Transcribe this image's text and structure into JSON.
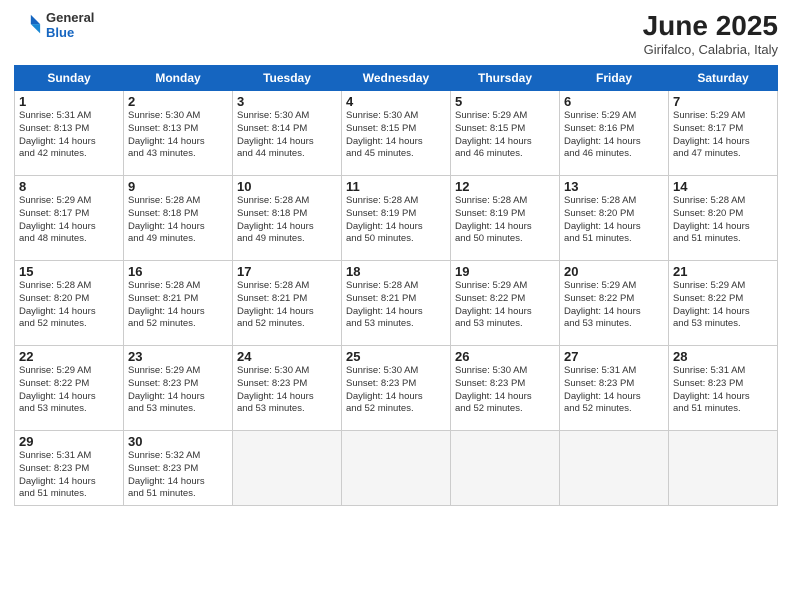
{
  "logo": {
    "general": "General",
    "blue": "Blue"
  },
  "title": "June 2025",
  "subtitle": "Girifalco, Calabria, Italy",
  "headers": [
    "Sunday",
    "Monday",
    "Tuesday",
    "Wednesday",
    "Thursday",
    "Friday",
    "Saturday"
  ],
  "weeks": [
    [
      {
        "day": "1",
        "info": "Sunrise: 5:31 AM\nSunset: 8:13 PM\nDaylight: 14 hours\nand 42 minutes."
      },
      {
        "day": "2",
        "info": "Sunrise: 5:30 AM\nSunset: 8:13 PM\nDaylight: 14 hours\nand 43 minutes."
      },
      {
        "day": "3",
        "info": "Sunrise: 5:30 AM\nSunset: 8:14 PM\nDaylight: 14 hours\nand 44 minutes."
      },
      {
        "day": "4",
        "info": "Sunrise: 5:30 AM\nSunset: 8:15 PM\nDaylight: 14 hours\nand 45 minutes."
      },
      {
        "day": "5",
        "info": "Sunrise: 5:29 AM\nSunset: 8:15 PM\nDaylight: 14 hours\nand 46 minutes."
      },
      {
        "day": "6",
        "info": "Sunrise: 5:29 AM\nSunset: 8:16 PM\nDaylight: 14 hours\nand 46 minutes."
      },
      {
        "day": "7",
        "info": "Sunrise: 5:29 AM\nSunset: 8:17 PM\nDaylight: 14 hours\nand 47 minutes."
      }
    ],
    [
      {
        "day": "8",
        "info": "Sunrise: 5:29 AM\nSunset: 8:17 PM\nDaylight: 14 hours\nand 48 minutes."
      },
      {
        "day": "9",
        "info": "Sunrise: 5:28 AM\nSunset: 8:18 PM\nDaylight: 14 hours\nand 49 minutes."
      },
      {
        "day": "10",
        "info": "Sunrise: 5:28 AM\nSunset: 8:18 PM\nDaylight: 14 hours\nand 49 minutes."
      },
      {
        "day": "11",
        "info": "Sunrise: 5:28 AM\nSunset: 8:19 PM\nDaylight: 14 hours\nand 50 minutes."
      },
      {
        "day": "12",
        "info": "Sunrise: 5:28 AM\nSunset: 8:19 PM\nDaylight: 14 hours\nand 50 minutes."
      },
      {
        "day": "13",
        "info": "Sunrise: 5:28 AM\nSunset: 8:20 PM\nDaylight: 14 hours\nand 51 minutes."
      },
      {
        "day": "14",
        "info": "Sunrise: 5:28 AM\nSunset: 8:20 PM\nDaylight: 14 hours\nand 51 minutes."
      }
    ],
    [
      {
        "day": "15",
        "info": "Sunrise: 5:28 AM\nSunset: 8:20 PM\nDaylight: 14 hours\nand 52 minutes."
      },
      {
        "day": "16",
        "info": "Sunrise: 5:28 AM\nSunset: 8:21 PM\nDaylight: 14 hours\nand 52 minutes."
      },
      {
        "day": "17",
        "info": "Sunrise: 5:28 AM\nSunset: 8:21 PM\nDaylight: 14 hours\nand 52 minutes."
      },
      {
        "day": "18",
        "info": "Sunrise: 5:28 AM\nSunset: 8:21 PM\nDaylight: 14 hours\nand 53 minutes."
      },
      {
        "day": "19",
        "info": "Sunrise: 5:29 AM\nSunset: 8:22 PM\nDaylight: 14 hours\nand 53 minutes."
      },
      {
        "day": "20",
        "info": "Sunrise: 5:29 AM\nSunset: 8:22 PM\nDaylight: 14 hours\nand 53 minutes."
      },
      {
        "day": "21",
        "info": "Sunrise: 5:29 AM\nSunset: 8:22 PM\nDaylight: 14 hours\nand 53 minutes."
      }
    ],
    [
      {
        "day": "22",
        "info": "Sunrise: 5:29 AM\nSunset: 8:22 PM\nDaylight: 14 hours\nand 53 minutes."
      },
      {
        "day": "23",
        "info": "Sunrise: 5:29 AM\nSunset: 8:23 PM\nDaylight: 14 hours\nand 53 minutes."
      },
      {
        "day": "24",
        "info": "Sunrise: 5:30 AM\nSunset: 8:23 PM\nDaylight: 14 hours\nand 53 minutes."
      },
      {
        "day": "25",
        "info": "Sunrise: 5:30 AM\nSunset: 8:23 PM\nDaylight: 14 hours\nand 52 minutes."
      },
      {
        "day": "26",
        "info": "Sunrise: 5:30 AM\nSunset: 8:23 PM\nDaylight: 14 hours\nand 52 minutes."
      },
      {
        "day": "27",
        "info": "Sunrise: 5:31 AM\nSunset: 8:23 PM\nDaylight: 14 hours\nand 52 minutes."
      },
      {
        "day": "28",
        "info": "Sunrise: 5:31 AM\nSunset: 8:23 PM\nDaylight: 14 hours\nand 51 minutes."
      }
    ],
    [
      {
        "day": "29",
        "info": "Sunrise: 5:31 AM\nSunset: 8:23 PM\nDaylight: 14 hours\nand 51 minutes."
      },
      {
        "day": "30",
        "info": "Sunrise: 5:32 AM\nSunset: 8:23 PM\nDaylight: 14 hours\nand 51 minutes."
      },
      {
        "day": "",
        "info": ""
      },
      {
        "day": "",
        "info": ""
      },
      {
        "day": "",
        "info": ""
      },
      {
        "day": "",
        "info": ""
      },
      {
        "day": "",
        "info": ""
      }
    ]
  ]
}
